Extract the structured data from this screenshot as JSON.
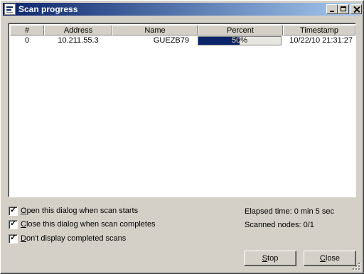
{
  "window": {
    "title": "Scan progress",
    "controls": [
      "minimize",
      "maximize",
      "close"
    ]
  },
  "table": {
    "columns": [
      "#",
      "Address",
      "Name",
      "Percent",
      "Timestamp"
    ],
    "rows": [
      {
        "index": "0",
        "address": "10.211.55.3",
        "name": "GUEZB79",
        "percent": 0.5,
        "percent_label": "50%",
        "timestamp": "10/22/10 21:31:27"
      }
    ]
  },
  "options": [
    {
      "label_first": "O",
      "label_rest": "pen this dialog when scan starts",
      "checked": true
    },
    {
      "label_first": "C",
      "label_rest": "lose this dialog when scan completes",
      "checked": true
    },
    {
      "label_first": "D",
      "label_rest": "on't display completed scans",
      "checked": true
    }
  ],
  "status": {
    "elapsed": "Elapsed time: 0 min 5 sec",
    "scanned": "Scanned nodes: 0/1"
  },
  "buttons": {
    "stop_first": "S",
    "stop_rest": "top",
    "close_first": "C",
    "close_rest": "lose"
  },
  "colors": {
    "title_start": "#0a246a",
    "title_end": "#a6caf0",
    "progress": "#0a246a",
    "face": "#d4d0c8"
  }
}
